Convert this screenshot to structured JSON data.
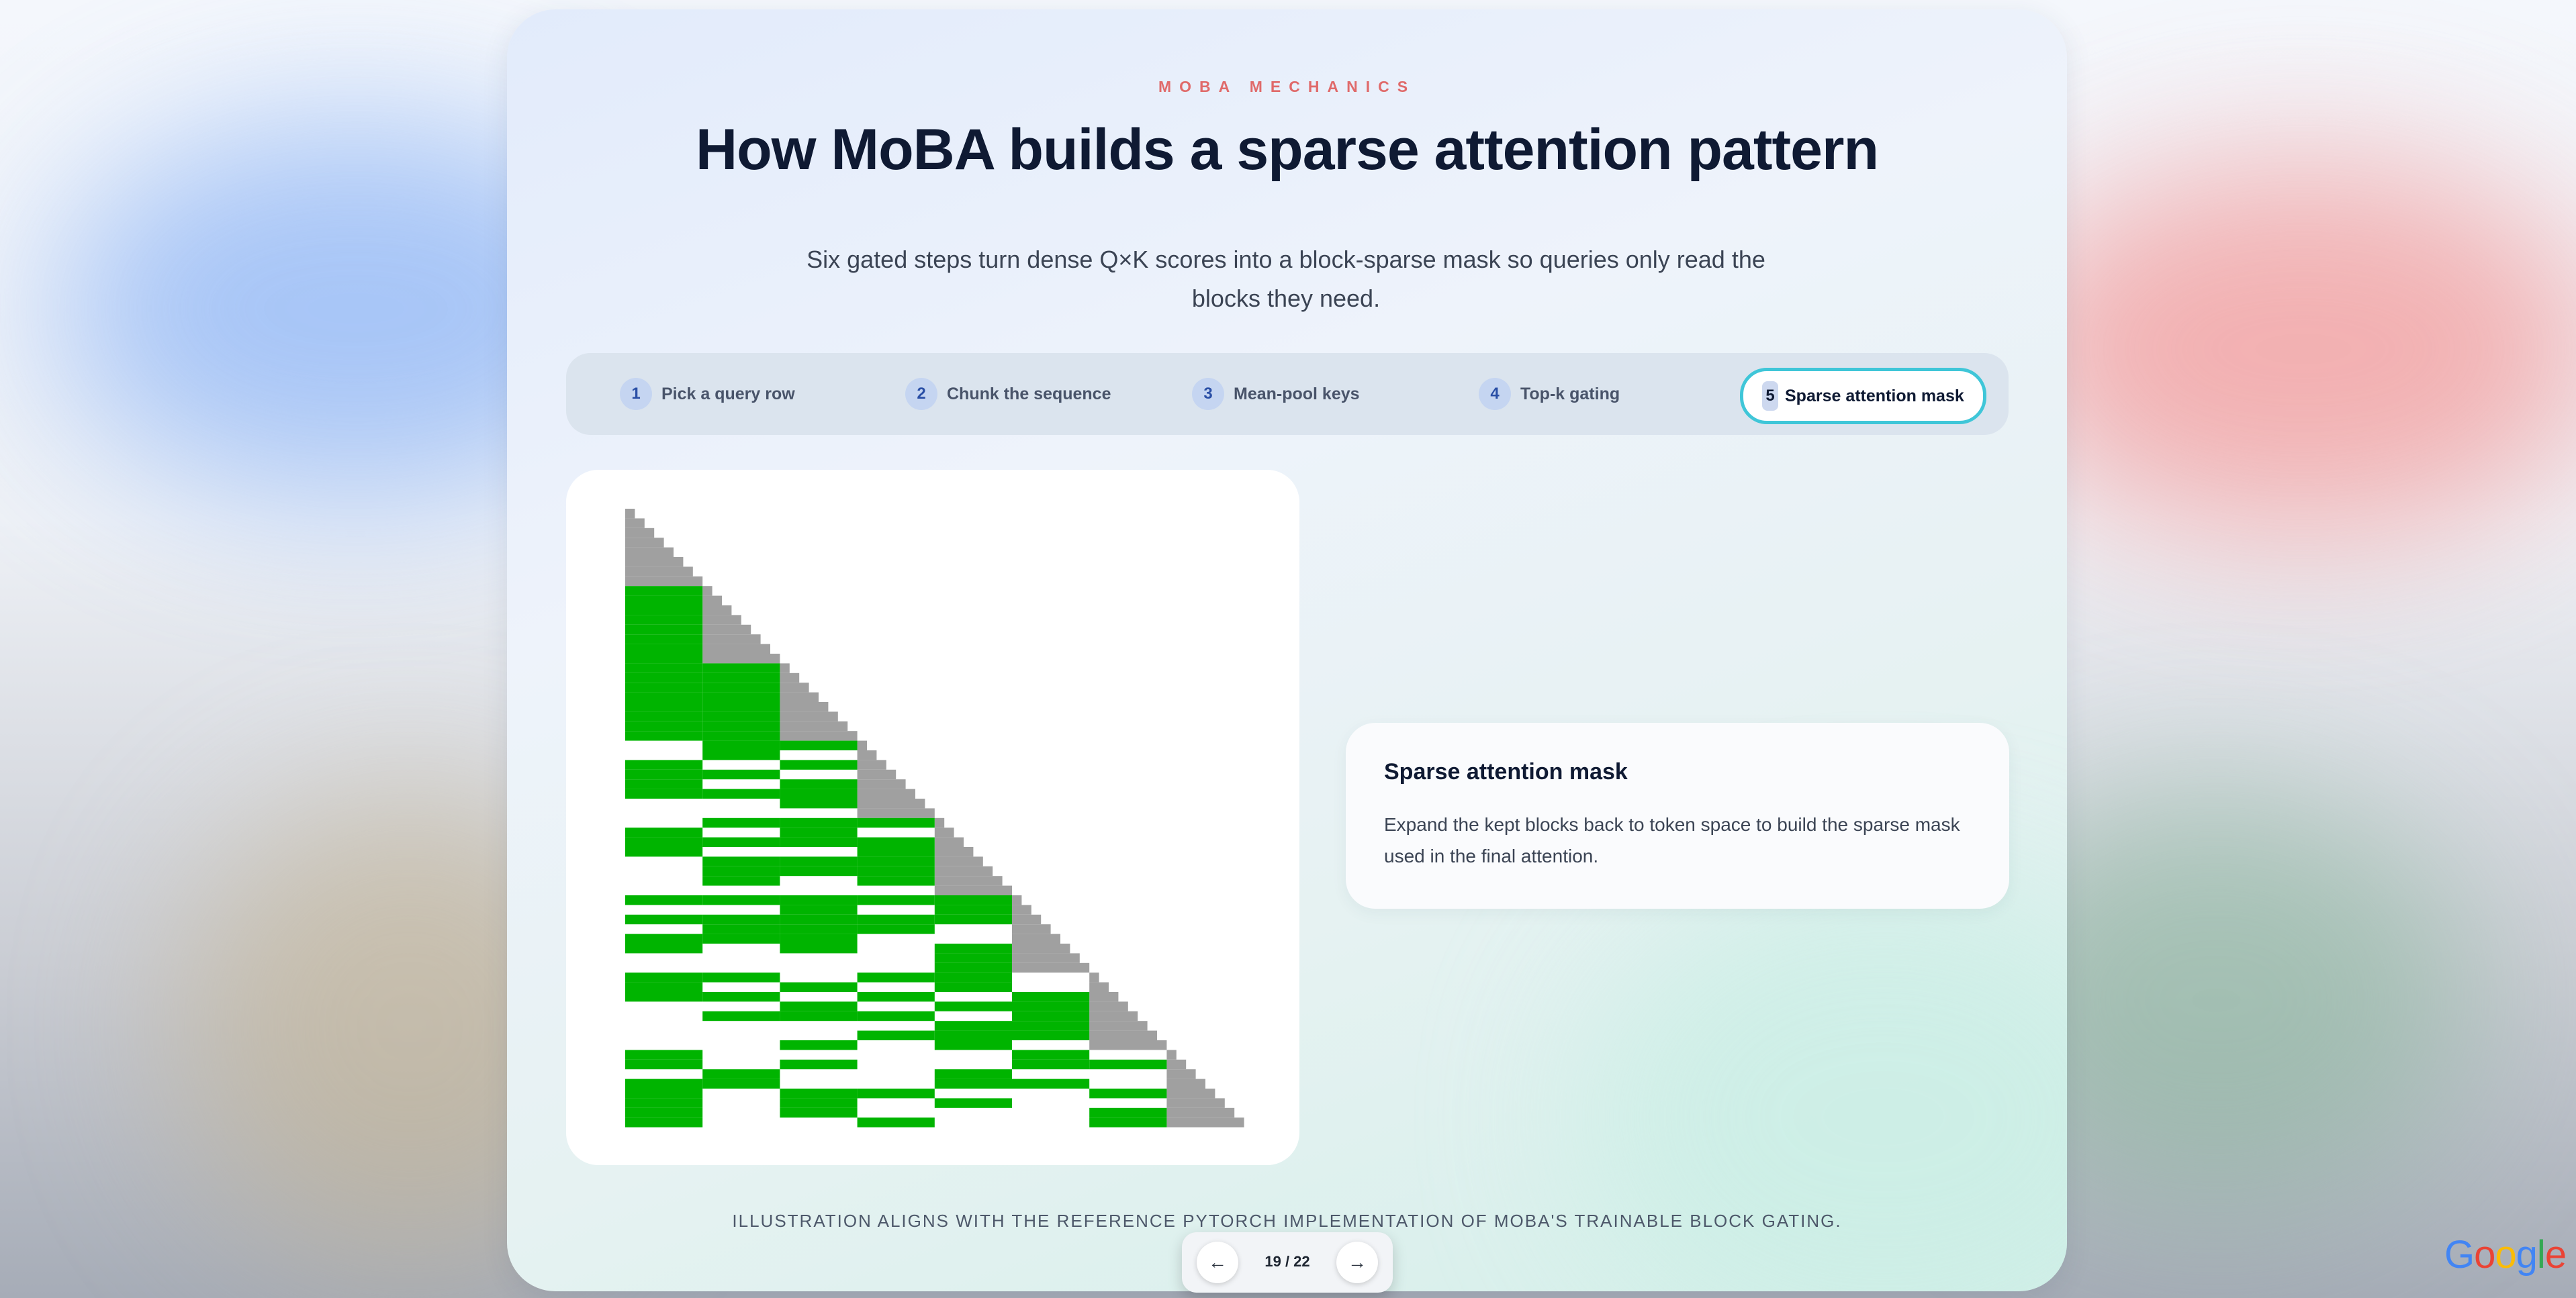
{
  "slide": {
    "eyebrow": "MOBA MECHANICS",
    "title": "How MoBA builds a sparse attention pattern",
    "subtitle": "Six gated steps turn dense Q×K scores into a block-sparse mask so queries only read the blocks they need."
  },
  "steps": [
    {
      "num": "1",
      "label": "Pick a query row"
    },
    {
      "num": "2",
      "label": "Chunk the sequence"
    },
    {
      "num": "3",
      "label": "Mean-pool keys"
    },
    {
      "num": "4",
      "label": "Top-k gating"
    },
    {
      "num": "5",
      "label": "Sparse attention mask"
    }
  ],
  "active_step": 5,
  "card": {
    "title": "Sparse attention mask",
    "body": "Expand the kept blocks back to token space to build the sparse mask used in the final attention."
  },
  "footnote": "ILLUSTRATION ALIGNS WITH THE REFERENCE PYTORCH IMPLEMENTATION OF MOBA'S TRAINABLE BLOCK GATING.",
  "pager": {
    "prev": "←",
    "next": "→",
    "count": "19 / 22"
  },
  "logo": {
    "text": "Google",
    "colors": [
      "#4285F4",
      "#EA4335",
      "#FBBC05",
      "#4285F4",
      "#34A853",
      "#EA4335"
    ]
  },
  "mask": {
    "blocks": 8,
    "block_size": 8,
    "causal_color": "#a0a0a0",
    "kept_color": "#00b400",
    "kept_rows_by_block": [
      [],
      [
        [
          0,
          0,
          1,
          2,
          3,
          4,
          5,
          6,
          7
        ]
      ],
      [
        [
          0,
          0,
          1,
          2,
          3,
          4,
          5,
          6,
          7
        ],
        [
          1,
          0,
          1,
          2,
          3,
          4,
          5,
          6,
          7
        ]
      ],
      [
        [
          0,
          2,
          3,
          4,
          5
        ],
        [
          1,
          0,
          1,
          3,
          5
        ],
        [
          2,
          0,
          2,
          4,
          5,
          6
        ]
      ],
      [
        [
          0,
          1,
          2,
          3
        ],
        [
          1,
          0,
          2,
          4,
          5,
          6
        ],
        [
          2,
          0,
          1,
          2,
          4,
          5
        ],
        [
          3,
          0,
          2,
          3,
          4,
          5,
          6
        ]
      ],
      [
        [
          0,
          0,
          2,
          4,
          5
        ],
        [
          1,
          0,
          2,
          3,
          4
        ],
        [
          2,
          0,
          1,
          2,
          3,
          4,
          5
        ],
        [
          3,
          0,
          2,
          3
        ],
        [
          4,
          0,
          1,
          2,
          5,
          6,
          7
        ]
      ],
      [
        [
          0,
          0,
          1,
          2
        ],
        [
          1,
          0,
          2,
          4
        ],
        [
          2,
          1,
          3,
          4,
          7
        ],
        [
          3,
          0,
          2,
          4,
          6
        ],
        [
          4,
          0,
          1,
          3,
          5,
          6,
          7
        ],
        [
          5,
          2,
          3,
          4,
          5,
          6
        ]
      ],
      [
        [
          0,
          0,
          1,
          3,
          4,
          5,
          6,
          7
        ],
        [
          1,
          2,
          3
        ],
        [
          2,
          1,
          4,
          5,
          6
        ],
        [
          3,
          4,
          7
        ],
        [
          4,
          2,
          3,
          5
        ],
        [
          5,
          0,
          1,
          3
        ],
        [
          6,
          1,
          4,
          6,
          7
        ]
      ]
    ]
  }
}
